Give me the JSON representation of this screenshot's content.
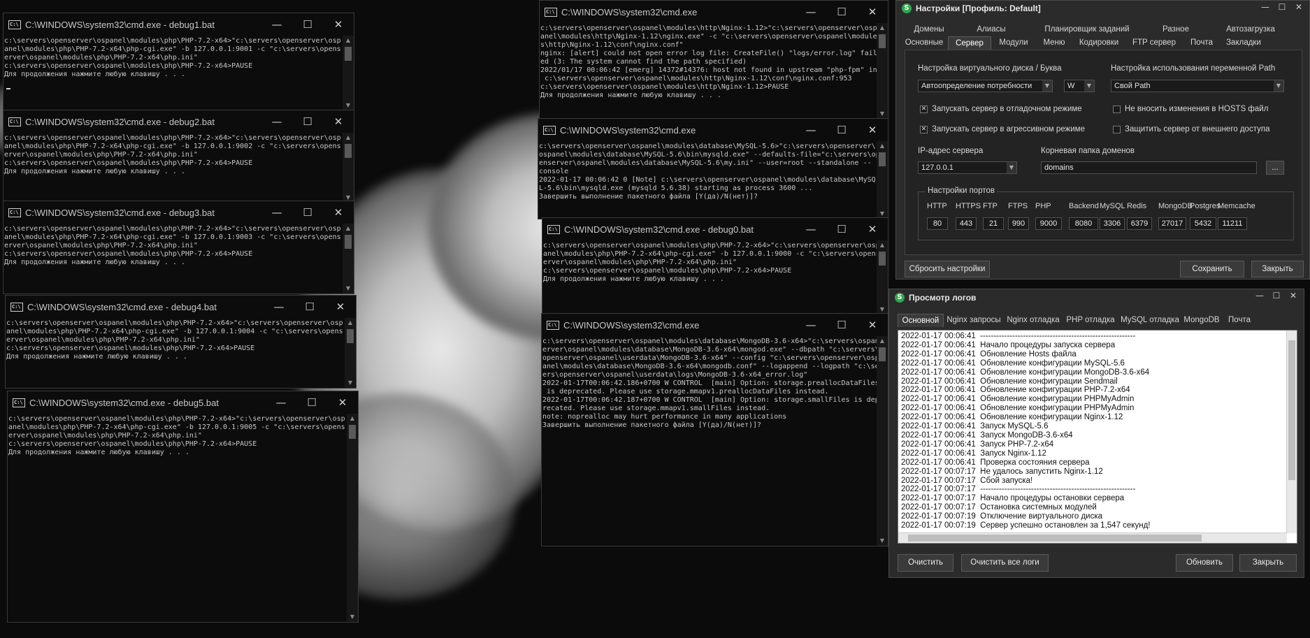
{
  "consoles": [
    {
      "id": "debug1",
      "title": "C:\\WINDOWS\\system32\\cmd.exe - debug1.bat",
      "lines": [
        "c:\\servers\\openserver\\ospanel\\modules\\php\\PHP-7.2-x64>\"c:\\servers\\openserver\\osp",
        "anel\\modules\\php\\PHP-7.2-x64\\php-cgi.exe\" -b 127.0.0.1:9001 -c \"c:\\servers\\opens",
        "erver\\ospanel\\modules\\php\\PHP-7.2-x64\\php.ini\"",
        "",
        "c:\\servers\\openserver\\ospanel\\modules\\php\\PHP-7.2-x64>PAUSE",
        "Для продолжения нажмите любую клавишу . . ."
      ]
    },
    {
      "id": "debug2",
      "title": "C:\\WINDOWS\\system32\\cmd.exe - debug2.bat",
      "lines": [
        "c:\\servers\\openserver\\ospanel\\modules\\php\\PHP-7.2-x64>\"c:\\servers\\openserver\\osp",
        "anel\\modules\\php\\PHP-7.2-x64\\php-cgi.exe\" -b 127.0.0.1:9002 -c \"c:\\servers\\opens",
        "erver\\ospanel\\modules\\php\\PHP-7.2-x64\\php.ini\"",
        "",
        "c:\\servers\\openserver\\ospanel\\modules\\php\\PHP-7.2-x64>PAUSE",
        "Для продолжения нажмите любую клавишу . . ."
      ]
    },
    {
      "id": "debug3",
      "title": "C:\\WINDOWS\\system32\\cmd.exe - debug3.bat",
      "lines": [
        "c:\\servers\\openserver\\ospanel\\modules\\php\\PHP-7.2-x64>\"c:\\servers\\openserver\\osp",
        "anel\\modules\\php\\PHP-7.2-x64\\php-cgi.exe\" -b 127.0.0.1:9003 -c \"c:\\servers\\opens",
        "erver\\ospanel\\modules\\php\\PHP-7.2-x64\\php.ini\"",
        "",
        "c:\\servers\\openserver\\ospanel\\modules\\php\\PHP-7.2-x64>PAUSE",
        "Для продолжения нажмите любую клавишу . . ."
      ]
    },
    {
      "id": "debug4",
      "title": "C:\\WINDOWS\\system32\\cmd.exe - debug4.bat",
      "lines": [
        "c:\\servers\\openserver\\ospanel\\modules\\php\\PHP-7.2-x64>\"c:\\servers\\openserver\\osp",
        "anel\\modules\\php\\PHP-7.2-x64\\php-cgi.exe\" -b 127.0.0.1:9004 -c \"c:\\servers\\opens",
        "erver\\ospanel\\modules\\php\\PHP-7.2-x64\\php.ini\"",
        "",
        "c:\\servers\\openserver\\ospanel\\modules\\php\\PHP-7.2-x64>PAUSE",
        "Для продолжения нажмите любую клавишу . . ."
      ]
    },
    {
      "id": "debug5",
      "title": "C:\\WINDOWS\\system32\\cmd.exe - debug5.bat",
      "lines": [
        "c:\\servers\\openserver\\ospanel\\modules\\php\\PHP-7.2-x64>\"c:\\servers\\openserver\\osp",
        "anel\\modules\\php\\PHP-7.2-x64\\php-cgi.exe\" -b 127.0.0.1:9005 -c \"c:\\servers\\opens",
        "erver\\ospanel\\modules\\php\\PHP-7.2-x64\\php.ini\"",
        "",
        "c:\\servers\\openserver\\ospanel\\modules\\php\\PHP-7.2-x64>PAUSE",
        "Для продолжения нажмите любую клавишу . . ."
      ]
    },
    {
      "id": "nginx",
      "title": "C:\\WINDOWS\\system32\\cmd.exe",
      "lines": [
        "c:\\servers\\openserver\\ospanel\\modules\\http\\Nginx-1.12>\"c:\\servers\\openserver\\osp",
        "anel\\modules\\http\\Nginx-1.12\\nginx.exe\" -c \"c:\\servers\\openserver\\ospanel\\module",
        "s\\http\\Nginx-1.12\\conf\\nginx.conf\"",
        "nginx: [alert] could not open error log file: CreateFile() \"logs/error.log\" fail",
        "ed (3: The system cannot find the path specified)",
        "2022/01/17 00:06:42 [emerg] 14372#14376: host not found in upstream \"php-fpm\" in",
        " c:\\servers\\openserver\\ospanel\\modules\\http\\Nginx-1.12\\conf\\nginx.conf:953",
        "",
        "c:\\servers\\openserver\\ospanel\\modules\\http\\Nginx-1.12>PAUSE",
        "Для продолжения нажмите любую клавишу . . ."
      ]
    },
    {
      "id": "mysql",
      "title": "C:\\WINDOWS\\system32\\cmd.exe",
      "lines": [
        "c:\\servers\\openserver\\ospanel\\modules\\database\\MySQL-5.6>\"c:\\servers\\openserver\\",
        "ospanel\\modules\\database\\MySQL-5.6\\bin\\mysqld.exe\" --defaults-file=\"c:\\servers\\op",
        "enserver\\ospanel\\modules\\database\\MySQL-5.6\\my.ini\" --user=root --standalone --",
        "console",
        "2022-01-17 00:06:42 0 [Note] c:\\servers\\openserver\\ospanel\\modules\\database\\MySQ",
        "L-5.6\\bin\\mysqld.exe (mysqld 5.6.38) starting as process 3600 ...",
        "Завершить выполнение пакетного файла [Y(да)/N(нет)]?"
      ]
    },
    {
      "id": "debug0",
      "title": "C:\\WINDOWS\\system32\\cmd.exe - debug0.bat",
      "lines": [
        "c:\\servers\\openserver\\ospanel\\modules\\php\\PHP-7.2-x64>\"c:\\servers\\openserver\\osp",
        "anel\\modules\\php\\PHP-7.2-x64\\php-cgi.exe\" -b 127.0.0.1:9000 -c \"c:\\servers\\opens",
        "erver\\ospanel\\modules\\php\\PHP-7.2-x64\\php.ini\"",
        "",
        "c:\\servers\\openserver\\ospanel\\modules\\php\\PHP-7.2-x64>PAUSE",
        "Для продолжения нажмите любую клавишу . . ."
      ]
    },
    {
      "id": "mongo",
      "title": "C:\\WINDOWS\\system32\\cmd.exe",
      "lines": [
        "c:\\servers\\openserver\\ospanel\\modules\\database\\MongoDB-3.6-x64>\"c:\\servers\\ospanel\\",
        "erver\\ospanel\\modules\\database\\MongoDB-3.6-x64\\mongod.exe\" --dbpath \"c:\\servers\\",
        "openserver\\ospanel\\userdata\\MongoDB-3.6-x64\" --config \"c:\\servers\\openserver\\ospanel",
        "anel\\modules\\database\\MongoDB-3.6-x64\\mongodb.conf\" --logappend --logpath \"c:\\serv",
        "ers\\openserver\\ospanel\\userdata\\logs\\MongoDB-3.6-x64_error.log\"",
        "2022-01-17T00:06:42.186+0700 W CONTROL  [main] Option: storage.preallocDataFiles",
        " is deprecated. Please use storage.mmapv1.preallocDataFiles instead.",
        "2022-01-17T00:06:42.187+0700 W CONTROL  [main] Option: storage.smallFiles is dep",
        "recated. Please use storage.mmapv1.smallFiles instead.",
        "note: noprealloc may hurt performance in many applications",
        "Завершить выполнение пакетного файла [Y(да)/N(нет)]?"
      ]
    }
  ],
  "settings": {
    "title": "Настройки [Профиль: Default]",
    "tabs_row1": [
      "Домены",
      "Алиасы",
      "Планировщик заданий",
      "Разное",
      "Автозагрузка"
    ],
    "tabs_row2": [
      "Основные",
      "Сервер",
      "Модули",
      "Меню",
      "Кодировки",
      "FTP сервер",
      "Почта",
      "Закладки"
    ],
    "active_tab": "Сервер",
    "vdisk_label": "Настройка виртуального диска / Буква",
    "vdisk_value": "Автоопределение потребности",
    "vdisk_letter": "W",
    "path_label": "Настройка использования переменной Path",
    "path_value": "Свой Path",
    "check_debug": "Запускать сервер в отладочном режиме",
    "check_debug_on": true,
    "check_aggressive": "Запускать сервер в агрессивном режиме",
    "check_aggressive_on": true,
    "check_hosts": "Не вносить изменения в HOSTS файл",
    "check_hosts_on": false,
    "check_protect": "Защитить сервер от внешнего доступа",
    "check_protect_on": false,
    "ip_label": "IP-адрес сервера",
    "ip_value": "127.0.0.1",
    "root_label": "Корневая папка доменов",
    "root_value": "domains",
    "browse": "...",
    "ports_title": "Настройки портов",
    "ports": [
      {
        "name": "HTTP",
        "value": "80"
      },
      {
        "name": "HTTPS",
        "value": "443"
      },
      {
        "name": "FTP",
        "value": "21"
      },
      {
        "name": "FTPS",
        "value": "990"
      },
      {
        "name": "PHP",
        "value": "9000"
      },
      {
        "name": "Backend",
        "value": "8080"
      },
      {
        "name": "MySQL",
        "value": "3306"
      },
      {
        "name": "Redis",
        "value": "6379"
      },
      {
        "name": "MongoDB",
        "value": "27017"
      },
      {
        "name": "Postgres",
        "value": "5432"
      },
      {
        "name": "Memcache",
        "value": "11211"
      }
    ],
    "reset_btn": "Сбросить настройки",
    "save_btn": "Сохранить",
    "close_btn": "Закрыть"
  },
  "logs": {
    "title": "Просмотр логов",
    "tabs": [
      "Основной",
      "Nginx запросы",
      "Nginx отладка",
      "PHP отладка",
      "MySQL отладка",
      "MongoDB",
      "Почта"
    ],
    "active_tab": "Основной",
    "lines": [
      "2022-01-17 00:06:41  ----------------------------------------------------------",
      "2022-01-17 00:06:41  Начало процедуры запуска сервера",
      "2022-01-17 00:06:41  Обновление Hosts файла",
      "2022-01-17 00:06:41  Обновление конфигурации MySQL-5.6",
      "2022-01-17 00:06:41  Обновление конфигурации MongoDB-3.6-x64",
      "2022-01-17 00:06:41  Обновление конфигурации Sendmail",
      "2022-01-17 00:06:41  Обновление конфигурации PHP-7.2-x64",
      "2022-01-17 00:06:41  Обновление конфигурации PHPMyAdmin",
      "2022-01-17 00:06:41  Обновление конфигурации PHPMyAdmin",
      "2022-01-17 00:06:41  Обновление конфигурации Nginx-1.12",
      "2022-01-17 00:06:41  Запуск MySQL-5.6",
      "2022-01-17 00:06:41  Запуск MongoDB-3.6-x64",
      "2022-01-17 00:06:41  Запуск PHP-7.2-x64",
      "2022-01-17 00:06:41  Запуск Nginx-1.12",
      "2022-01-17 00:06:41  Проверка состояния сервера",
      "2022-01-17 00:07:17  Не удалось запустить Nginx-1.12",
      "2022-01-17 00:07:17  Сбой запуска!",
      "2022-01-17 00:07:17  ----------------------------------------------------------",
      "2022-01-17 00:07:17  Начало процедуры остановки сервера",
      "2022-01-17 00:07:17  Остановка системных модулей",
      "2022-01-17 00:07:19  Отключение виртуального диска",
      "2022-01-17 00:07:19  Сервер успешно остановлен за 1,547 секунд!"
    ],
    "clear_btn": "Очистить",
    "clear_all_btn": "Очистить все логи",
    "refresh_btn": "Обновить",
    "close_btn": "Закрыть"
  },
  "win_controls": {
    "min": "—",
    "max": "☐",
    "close": "✕"
  },
  "colors": {
    "logo_green": "#2fa84f",
    "console_bg": "#0c0c0c",
    "dialog_bg": "#2b2b2b"
  }
}
